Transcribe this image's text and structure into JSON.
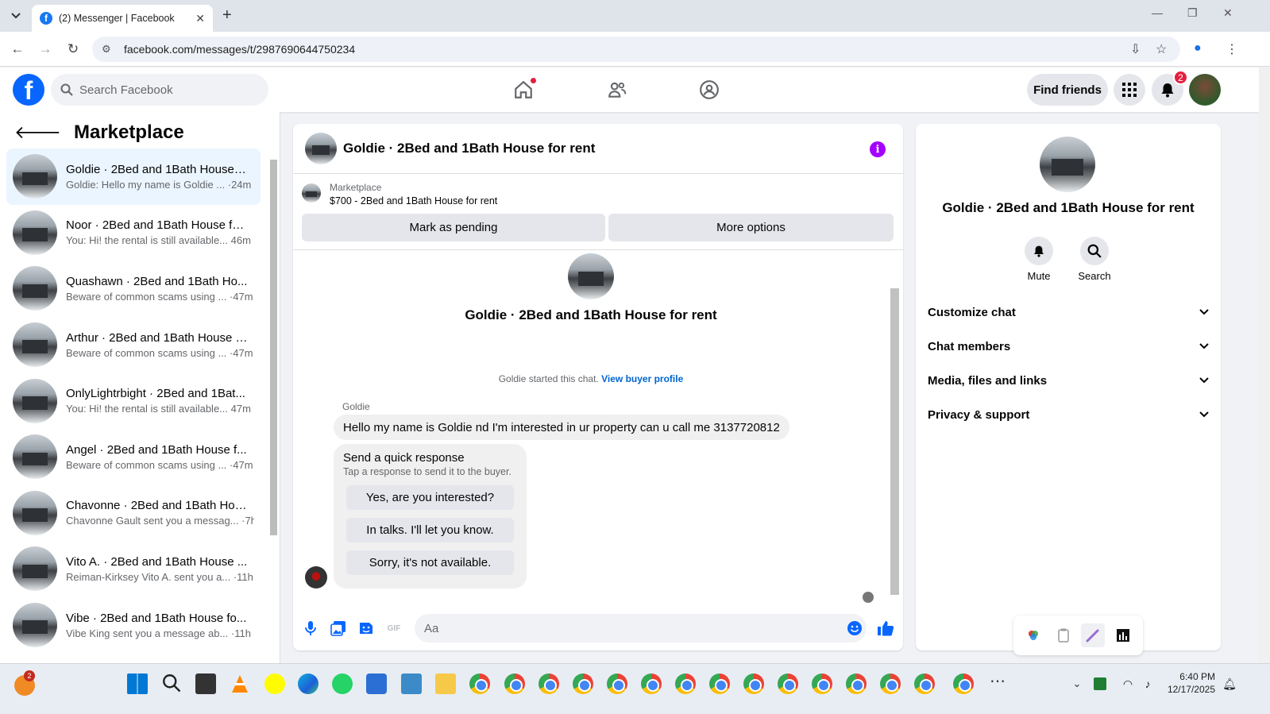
{
  "browser": {
    "tab_title": "(2) Messenger | Facebook",
    "url": "facebook.com/messages/t/2987690644750234",
    "new_tab": "+",
    "close_tab": "✕"
  },
  "fb_header": {
    "search_placeholder": "Search Facebook",
    "find_friends": "Find friends",
    "notification_count": "2"
  },
  "sidebar": {
    "title": "Marketplace",
    "conversations": [
      {
        "name": "Goldie · 2Bed and 1Bath House f...",
        "preview": "Goldie: Hello my name is Goldie ... ·24m"
      },
      {
        "name": "Noor · 2Bed and 1Bath House fo...",
        "preview": "You: Hi! the rental is still available... 46m"
      },
      {
        "name": "Quashawn · 2Bed and 1Bath Ho...",
        "preview": "Beware of common scams using ... ·47m"
      },
      {
        "name": "Arthur · 2Bed and 1Bath House f...",
        "preview": "Beware of common scams using ... ·47m"
      },
      {
        "name": "OnlyLightrbight · 2Bed and 1Bat...",
        "preview": "You: Hi! the rental is still available... 47m"
      },
      {
        "name": "Angel · 2Bed and 1Bath House f...",
        "preview": "Beware of common scams using ... ·47m"
      },
      {
        "name": "Chavonne · 2Bed and 1Bath Hou...",
        "preview": "Chavonne Gault sent you a messag... ·7h"
      },
      {
        "name": "Vito A. · 2Bed and 1Bath House ...",
        "preview": "Reiman-Kirksey Vito A. sent you a... ·11h"
      },
      {
        "name": "Vibe · 2Bed and 1Bath House fo...",
        "preview": "Vibe King sent you a message ab... ·11h"
      }
    ]
  },
  "chat": {
    "title": "Goldie · 2Bed and 1Bath House for rent",
    "marketplace_label": "Marketplace",
    "listing": "$700 - 2Bed and 1Bath House for rent",
    "mark_pending": "Mark as pending",
    "more_options": "More options",
    "intro_title": "Goldie · 2Bed and 1Bath House for rent",
    "started_text": "Goldie started this chat.",
    "view_profile": "View buyer profile",
    "sender": "Goldie",
    "message": "Hello my name is Goldie nd I'm interested in ur property can u call me 3137720812",
    "quick_title": "Send a quick response",
    "quick_sub": "Tap a response to send it to the buyer.",
    "quick_options": [
      "Yes, are you interested?",
      "In talks. I'll let you know.",
      "Sorry, it's not available."
    ],
    "composer_placeholder": "Aa"
  },
  "info_panel": {
    "title": "Goldie · 2Bed and 1Bath House for rent",
    "mute": "Mute",
    "search": "Search",
    "rows": [
      "Customize chat",
      "Chat members",
      "Media, files and links",
      "Privacy & support"
    ]
  },
  "taskbar": {
    "time": "6:40 PM",
    "date": "12/17/2025",
    "weather_badge": "2"
  }
}
